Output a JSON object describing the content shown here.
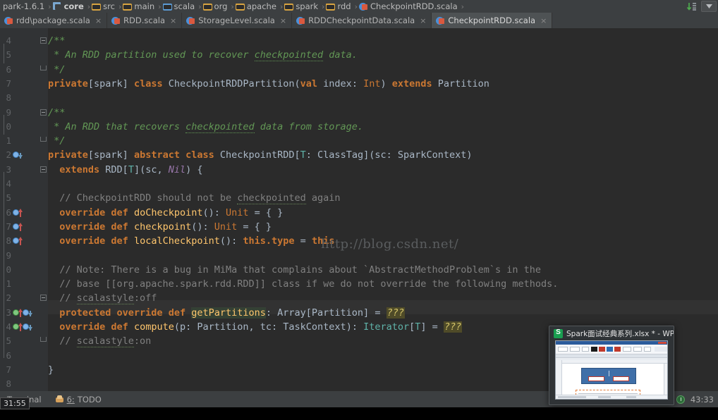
{
  "navbar": {
    "crumbs": [
      {
        "label": "park-1.6.1",
        "icon": "none",
        "bold": false
      },
      {
        "label": "core",
        "icon": "module-icon",
        "bold": true
      },
      {
        "label": "src",
        "icon": "folder-icon",
        "bold": false
      },
      {
        "label": "main",
        "icon": "folder-icon",
        "bold": false
      },
      {
        "label": "scala",
        "icon": "folder-blue-icon",
        "bold": false
      },
      {
        "label": "org",
        "icon": "folder-icon",
        "bold": false
      },
      {
        "label": "apache",
        "icon": "folder-icon",
        "bold": false
      },
      {
        "label": "spark",
        "icon": "folder-icon",
        "bold": false
      },
      {
        "label": "rdd",
        "icon": "folder-icon",
        "bold": false
      },
      {
        "label": "CheckpointRDD.scala",
        "icon": "scala-file-icon",
        "bold": false
      }
    ],
    "separator": "›",
    "right_buttons": [
      {
        "name": "sort-by-icon",
        "glyph": "↓"
      },
      {
        "name": "chevron-down-icon",
        "glyph": "▼"
      }
    ]
  },
  "tabs": [
    {
      "label": "rdd\\package.scala",
      "active": false,
      "close": "×"
    },
    {
      "label": "RDD.scala",
      "active": false,
      "close": "×"
    },
    {
      "label": "StorageLevel.scala",
      "active": false,
      "close": "×"
    },
    {
      "label": "RDDCheckpointData.scala",
      "active": false,
      "close": "×"
    },
    {
      "label": "CheckpointRDD.scala",
      "active": true,
      "close": "×"
    }
  ],
  "editor": {
    "watermark": "http://blog.csdn.net/",
    "line_numbers": [
      "4",
      "5",
      "6",
      "7",
      "8",
      "9",
      "0",
      "1",
      "2",
      "3",
      "4",
      "5",
      "6",
      "7",
      "8",
      "9",
      "0",
      "1",
      "2",
      "3",
      "4",
      "5",
      "6",
      "7",
      "8"
    ],
    "caret_line_index": 19,
    "lines": [
      "/**",
      " * An RDD partition used to recover checkpointed data.",
      " */",
      "private[spark] class CheckpointRDDPartition(val index: Int) extends Partition",
      "",
      "/**",
      " * An RDD that recovers checkpointed data from storage.",
      " */",
      "private[spark] abstract class CheckpointRDD[T: ClassTag](sc: SparkContext)",
      "  extends RDD[T](sc, Nil) {",
      "",
      "  // CheckpointRDD should not be checkpointed again",
      "  override def doCheckpoint(): Unit = { }",
      "  override def checkpoint(): Unit = { }",
      "  override def localCheckpoint(): this.type = this",
      "",
      "  // Note: There is a bug in MiMa that complains about `AbstractMethodProblem`s in the",
      "  // base [[org.apache.spark.rdd.RDD]] class if we do not override the following methods.",
      "  // scalastyle:off",
      "  protected override def getPartitions: Array[Partition] = ???",
      "  override def compute(p: Partition, tc: TaskContext): Iterator[T] = ???",
      "  // scalastyle:on",
      "",
      "}",
      ""
    ]
  },
  "statusbar": {
    "terminal_label": "Terminal",
    "todo_label": "TODO",
    "todo_number": "6:",
    "position": "43:33",
    "tooltip": "31:55"
  },
  "thumbnail": {
    "title": "Spark面试经典系列.xlsx * - WP...",
    "app_icon": "wps-spreadsheet-icon"
  },
  "colors": {
    "editor_bg": "#2b2b2b",
    "gutter_bg": "#313335",
    "chrome_bg": "#3c3f41",
    "keyword": "#cc7832",
    "doc_comment": "#629755",
    "comment": "#808080",
    "identifier": "#a9b7c6",
    "method": "#ffc66d",
    "type_param": "#5fb2a8",
    "literal_nil": "#9876aa",
    "placeholder_bg": "#4f4b28",
    "accent_green": "#1a9e50"
  }
}
